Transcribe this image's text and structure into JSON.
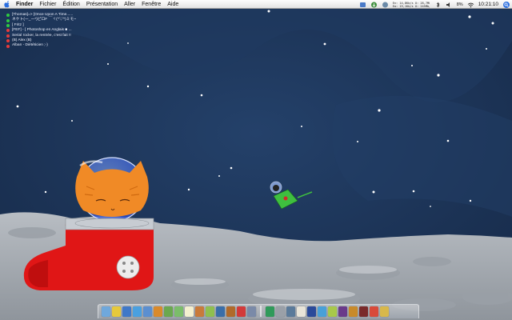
{
  "menubar": {
    "apple": "apple-icon",
    "items": [
      "Finder",
      "Fichier",
      "Édition",
      "Présentation",
      "Aller",
      "Fenêtre",
      "Aide"
    ],
    "netstats": [
      "En: 14,8Kb/s U: 28,7Mb/s",
      "Ea: 19,1Kb/s U: 245Mb/s"
    ],
    "battery": "8%",
    "clock": "10:21:10"
  },
  "buddies": [
    {
      "text": "[Thomas]=> [Once Upon A Time......",
      "status": "#2ecc40"
    },
    {
      "text": "ネケト(ー_ー*)ピロF ￣ヾ(^▽^)ミモ~",
      "status": "#2ecc40"
    },
    {
      "text": "[ Fritz ]",
      "status": "#2ecc40"
    },
    {
      "text": "[FEF] - [ Photoshop en Anglais ■ ...",
      "status": "#e83a3a"
    },
    {
      "text": "Serial rocker, la rentrée, c'est fait !!",
      "status": "#e83a3a"
    },
    {
      "text": "(B) Alex (B)",
      "status": "#e83a3a"
    },
    {
      "text": "Alban - Diététicien ;-)",
      "status": "#e83a3a"
    }
  ],
  "dock": {
    "icons": [
      {
        "name": "finder-icon",
        "color": "#6fa8dc"
      },
      {
        "name": "pencil-icon",
        "color": "#e6c93c"
      },
      {
        "name": "mail-icon",
        "color": "#3f78c8"
      },
      {
        "name": "safari-icon",
        "color": "#4aa0e0"
      },
      {
        "name": "chat-icon",
        "color": "#5b8fd0"
      },
      {
        "name": "coffee-icon",
        "color": "#d98a2b"
      },
      {
        "name": "leaf-icon",
        "color": "#6aa84f"
      },
      {
        "name": "book-icon",
        "color": "#7bbd6a"
      },
      {
        "name": "notes-icon",
        "color": "#f4f0d0"
      },
      {
        "name": "pie-icon",
        "color": "#c97a3a"
      },
      {
        "name": "robot-icon",
        "color": "#8fbf4f"
      },
      {
        "name": "globe-icon",
        "color": "#3a6ea8"
      },
      {
        "name": "jar-icon",
        "color": "#b06a2a"
      },
      {
        "name": "lollipop-icon",
        "color": "#d23a3a"
      },
      {
        "name": "truck-icon",
        "color": "#7a8aa8"
      },
      {
        "name": "folder-icon",
        "color": "#2f9a5a"
      },
      {
        "name": "drive-icon",
        "color": "#9aa0a8"
      },
      {
        "name": "image-icon",
        "color": "#5a7a9a"
      },
      {
        "name": "calendar-icon",
        "color": "#e8e4d8"
      },
      {
        "name": "book2-icon",
        "color": "#2a4a9a"
      },
      {
        "name": "doc-icon",
        "color": "#49a0d8"
      },
      {
        "name": "mug-icon",
        "color": "#a8c84a"
      },
      {
        "name": "film-icon",
        "color": "#6a3a8a"
      },
      {
        "name": "box-icon",
        "color": "#c88a2a"
      },
      {
        "name": "book3-icon",
        "color": "#7a2a2a"
      },
      {
        "name": "tag-icon",
        "color": "#d84a3a"
      },
      {
        "name": "trash-icon",
        "color": "#d8b84a"
      }
    ]
  }
}
